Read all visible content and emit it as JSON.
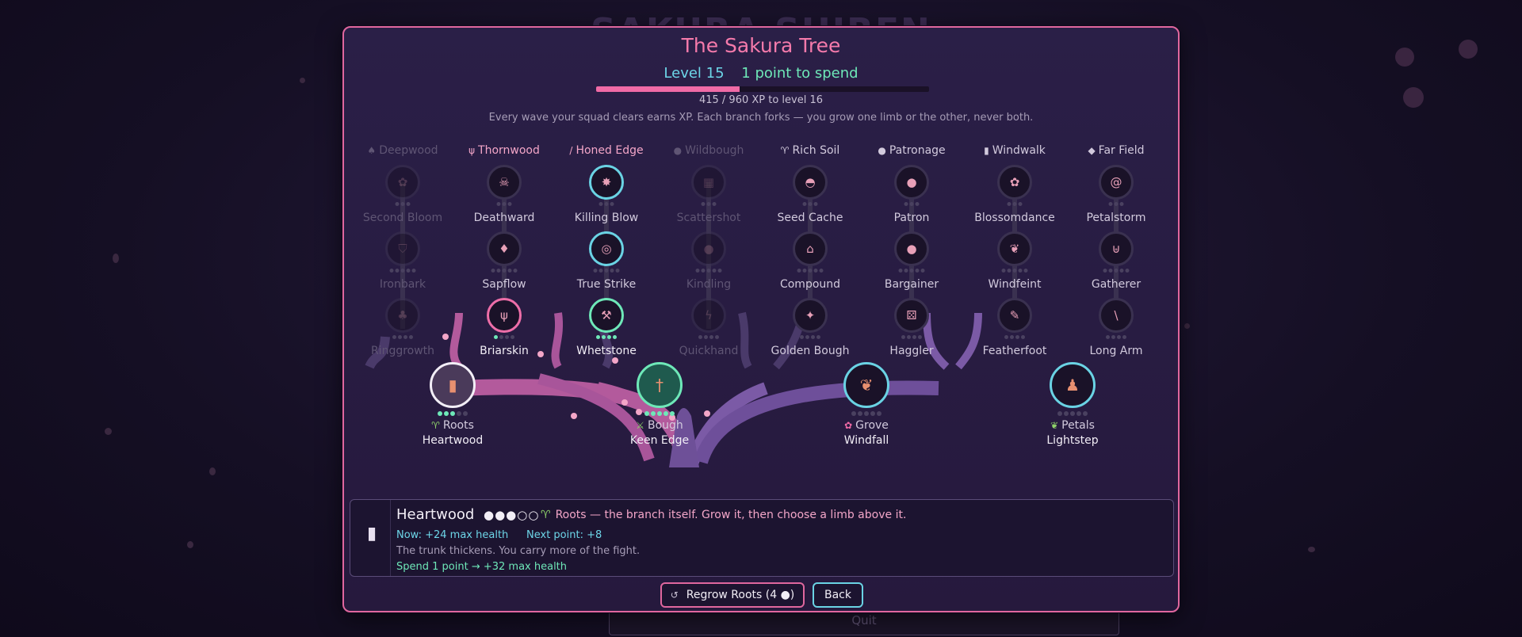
{
  "background": {
    "title": "SAKURA SHIREN",
    "quit_label": "Quit"
  },
  "header": {
    "title": "The Sakura Tree",
    "level": "Level 15",
    "points": "1 point to spend",
    "xp_text": "415 / 960 XP to level 16",
    "xp_fraction": 0.432,
    "hint": "Every wave your squad clears earns XP.   Each branch forks — you grow one limb or the other, never both."
  },
  "columns": [
    {
      "branch": "Deepwood",
      "branch_icon": "tree-icon",
      "glyph": "♠",
      "state": "dim",
      "nodes": [
        {
          "label": "Second Bloom",
          "icon": "flower-icon",
          "glyph": "✿",
          "ring": "none",
          "filled": 0,
          "pips": 3,
          "state": "dim"
        },
        {
          "label": "Ironbark",
          "icon": "shield-icon",
          "glyph": "⛉",
          "ring": "none",
          "filled": 0,
          "pips": 5,
          "state": "dim"
        },
        {
          "label": "Ringgrowth",
          "icon": "pine-icon",
          "glyph": "♣",
          "ring": "none",
          "filled": 0,
          "pips": 4,
          "state": "dim"
        }
      ]
    },
    {
      "branch": "Thornwood",
      "branch_icon": "cactus-icon",
      "glyph": "ψ",
      "state": "pink",
      "nodes": [
        {
          "label": "Deathward",
          "icon": "skull-icon",
          "glyph": "☠",
          "ring": "none",
          "filled": 0,
          "pips": 3,
          "state": "norm"
        },
        {
          "label": "Sapflow",
          "icon": "droplet-icon",
          "glyph": "♦",
          "ring": "none",
          "filled": 0,
          "pips": 5,
          "state": "norm"
        },
        {
          "label": "Briarskin",
          "icon": "cactus-icon",
          "glyph": "ψ",
          "ring": "pink",
          "filled": 1,
          "pips": 4,
          "state": "bright"
        }
      ]
    },
    {
      "branch": "Honed Edge",
      "branch_icon": "blade-icon",
      "glyph": "/",
      "state": "pink",
      "nodes": [
        {
          "label": "Killing Blow",
          "icon": "burst-icon",
          "glyph": "✸",
          "ring": "cyan",
          "filled": 0,
          "pips": 3,
          "state": "norm"
        },
        {
          "label": "True Strike",
          "icon": "target-icon",
          "glyph": "◎",
          "ring": "cyan",
          "filled": 0,
          "pips": 5,
          "state": "norm"
        },
        {
          "label": "Whetstone",
          "icon": "hammers-icon",
          "glyph": "⚒",
          "ring": "green",
          "filled": 4,
          "pips": 4,
          "state": "bright"
        }
      ]
    },
    {
      "branch": "Wildbough",
      "branch_icon": "seed-icon",
      "glyph": "●",
      "state": "dim",
      "nodes": [
        {
          "label": "Scattershot",
          "icon": "grid-icon",
          "glyph": "▦",
          "ring": "none",
          "filled": 0,
          "pips": 3,
          "state": "dim"
        },
        {
          "label": "Kindling",
          "icon": "ember-icon",
          "glyph": "●",
          "ring": "none",
          "filled": 0,
          "pips": 5,
          "state": "dim"
        },
        {
          "label": "Quickhand",
          "icon": "bolt-icon",
          "glyph": "ϟ",
          "ring": "none",
          "filled": 0,
          "pips": 4,
          "state": "dim"
        }
      ]
    },
    {
      "branch": "Rich Soil",
      "branch_icon": "sprout-icon",
      "glyph": "♈",
      "state": "norm",
      "nodes": [
        {
          "label": "Seed Cache",
          "icon": "bun-icon",
          "glyph": "◓",
          "ring": "none",
          "filled": 0,
          "pips": 3,
          "state": "norm"
        },
        {
          "label": "Compound",
          "icon": "bank-icon",
          "glyph": "⌂",
          "ring": "none",
          "filled": 0,
          "pips": 5,
          "state": "norm"
        },
        {
          "label": "Golden Bough",
          "icon": "sparkle-icon",
          "glyph": "✦",
          "ring": "none",
          "filled": 0,
          "pips": 4,
          "state": "norm"
        }
      ]
    },
    {
      "branch": "Patronage",
      "branch_icon": "coin-icon",
      "glyph": "●",
      "state": "norm",
      "nodes": [
        {
          "label": "Patron",
          "icon": "lantern-icon",
          "glyph": "●",
          "ring": "none",
          "filled": 0,
          "pips": 3,
          "state": "norm"
        },
        {
          "label": "Bargainer",
          "icon": "coin-icon",
          "glyph": "●",
          "ring": "none",
          "filled": 0,
          "pips": 5,
          "state": "norm"
        },
        {
          "label": "Haggler",
          "icon": "dice-icon",
          "glyph": "⚄",
          "ring": "none",
          "filled": 0,
          "pips": 4,
          "state": "norm"
        }
      ]
    },
    {
      "branch": "Windwalk",
      "branch_icon": "boot-icon",
      "glyph": "▮",
      "state": "norm",
      "nodes": [
        {
          "label": "Blossomdance",
          "icon": "blossom-icon",
          "glyph": "✿",
          "ring": "none",
          "filled": 0,
          "pips": 3,
          "state": "norm"
        },
        {
          "label": "Windfeint",
          "icon": "leaf-icon",
          "glyph": "❦",
          "ring": "none",
          "filled": 0,
          "pips": 5,
          "state": "norm"
        },
        {
          "label": "Featherfoot",
          "icon": "feather-icon",
          "glyph": "✎",
          "ring": "none",
          "filled": 0,
          "pips": 4,
          "state": "norm"
        }
      ]
    },
    {
      "branch": "Far Field",
      "branch_icon": "leaf-icon",
      "glyph": "◆",
      "state": "norm",
      "nodes": [
        {
          "label": "Petalstorm",
          "icon": "spiral-icon",
          "glyph": "@",
          "ring": "none",
          "filled": 0,
          "pips": 3,
          "state": "norm"
        },
        {
          "label": "Gatherer",
          "icon": "basket-icon",
          "glyph": "⊎",
          "ring": "none",
          "filled": 0,
          "pips": 5,
          "state": "norm"
        },
        {
          "label": "Long Arm",
          "icon": "spear-icon",
          "glyph": "\\",
          "ring": "none",
          "filled": 0,
          "pips": 4,
          "state": "norm"
        }
      ]
    }
  ],
  "base_nodes": [
    {
      "branch_label": "Roots",
      "branch_icon": "sprout-icon",
      "glyph": "♈",
      "label": "Heartwood",
      "icon": "log-icon",
      "node_glyph": "▮",
      "ring": "white",
      "filled": 3,
      "pips": 5
    },
    {
      "branch_label": "Bough",
      "branch_icon": "swords-icon",
      "glyph": "⚔",
      "label": "Keen Edge",
      "icon": "dagger-icon",
      "node_glyph": "†",
      "ring": "green",
      "filled": 5,
      "pips": 5
    },
    {
      "branch_label": "Grove",
      "branch_icon": "flower-icon",
      "glyph": "✿",
      "label": "Windfall",
      "icon": "leaves-icon",
      "node_glyph": "❦",
      "ring": "cyan",
      "filled": 0,
      "pips": 5
    },
    {
      "branch_label": "Petals",
      "branch_icon": "leaf-icon",
      "glyph": "❦",
      "label": "Lightstep",
      "icon": "footprints-icon",
      "node_glyph": "♟",
      "ring": "cyan",
      "filled": 0,
      "pips": 5
    }
  ],
  "info": {
    "icon": "log-icon",
    "name": "Heartwood",
    "pips": "●●●○○",
    "branch_icon": "sprout-icon",
    "desc": "Roots — the branch itself. Grow it, then choose a limb above it.",
    "now": "Now: +24 max health",
    "next": "Next point: +8",
    "flavor": "The trunk thickens. You carry more of the fight.",
    "spend": "Spend 1 point   →   +32 max health"
  },
  "buttons": {
    "regrow": "Regrow Roots   (4 ●)",
    "regrow_icon": "↺",
    "back": "Back"
  },
  "colors": {
    "accent_pink": "#e0679e",
    "accent_cyan": "#6ad3e4",
    "accent_green": "#6ee8b8",
    "panel": "#2a1f47"
  }
}
